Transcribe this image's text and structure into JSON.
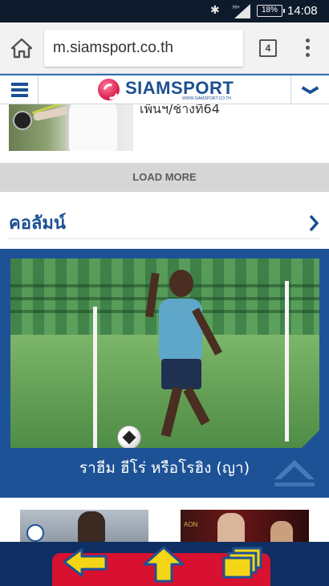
{
  "status_bar": {
    "battery": "18%",
    "time": "14:08"
  },
  "browser": {
    "url": "m.siamsport.co.th",
    "tab_count": "4"
  },
  "site_header": {
    "logo_text": "SIAMSPORT",
    "logo_subtext": "WWW.SIAMSPORT.CO.TH"
  },
  "news": {
    "partial_title": "เพ็นฯ/ช้างที64"
  },
  "load_more": {
    "label": "LOAD MORE"
  },
  "section": {
    "title": "คอลัมน์"
  },
  "feature": {
    "caption": "ราฮีม ฮีโร่ หรือโรฮิง (ญา)"
  },
  "thumb_right": {
    "sponsor_text": "AON"
  },
  "colors": {
    "brand_blue": "#1d5296",
    "accent_red": "#d7112f",
    "arrow_yellow": "#f5d617",
    "status_bar_bg": "#0d1a2b"
  },
  "icons": {
    "bluetooth": "bluetooth-icon",
    "signal": "signal-icon",
    "home": "home-icon",
    "overflow_menu": "more-vert-icon",
    "site_menu": "hamburger-icon",
    "dropdown": "chevron-down-icon",
    "section_more": "chevron-right-icon",
    "scroll_top": "chevron-up-icon",
    "back": "arrow-left-icon",
    "up": "arrow-up-icon",
    "windows": "windows-icon"
  }
}
